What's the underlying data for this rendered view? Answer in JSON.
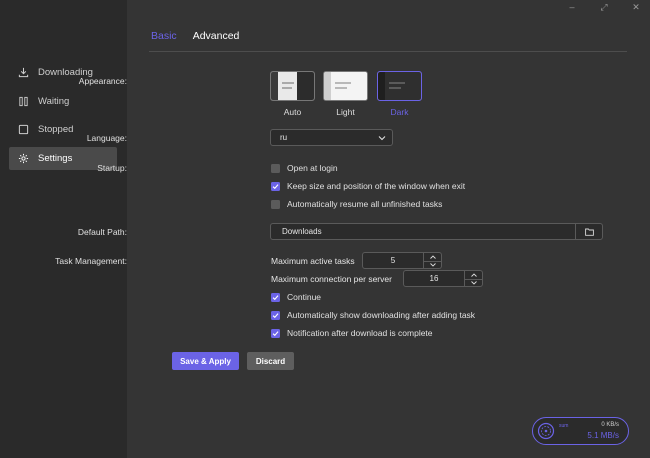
{
  "window_controls": {
    "minimize": "–",
    "maximize": "⤢",
    "close": "✕"
  },
  "sidebar": {
    "items": [
      {
        "label": "Downloading",
        "icon": "download-icon"
      },
      {
        "label": "Waiting",
        "icon": "pause-bars-icon"
      },
      {
        "label": "Stopped",
        "icon": "stop-square-icon"
      },
      {
        "label": "Settings",
        "icon": "gear-icon",
        "active": true
      }
    ]
  },
  "tabs": [
    {
      "label": "Basic",
      "active": true
    },
    {
      "label": "Advanced",
      "active": false
    }
  ],
  "form": {
    "appearance": {
      "label": "Appearance:",
      "options": [
        "Auto",
        "Light",
        "Dark"
      ],
      "selected": "Dark"
    },
    "language": {
      "label": "Language:",
      "value": "ru"
    },
    "startup": {
      "label": "Startup:",
      "options": [
        {
          "label": "Open at login",
          "checked": false
        },
        {
          "label": "Keep size and position of the window when exit",
          "checked": true
        },
        {
          "label": "Automatically resume all unfinished tasks",
          "checked": false
        }
      ]
    },
    "default_path": {
      "label": "Default Path:",
      "value": "Downloads"
    },
    "task_management": {
      "label": "Task Management:",
      "max_active_label": "Maximum active tasks",
      "max_active_value": "5",
      "max_conn_label": "Maximum connection per server",
      "max_conn_value": "16",
      "options": [
        {
          "label": "Continue",
          "checked": true
        },
        {
          "label": "Automatically show downloading after adding task",
          "checked": true
        },
        {
          "label": "Notification after download is complete",
          "checked": true
        }
      ]
    }
  },
  "buttons": {
    "save": "Save & Apply",
    "discard": "Discard"
  },
  "speedometer": {
    "mini_label": "sum",
    "upload": "0 KB/s",
    "download": "5.1 MB/s"
  },
  "colors": {
    "accent": "#6b63e6",
    "background": "#343434",
    "sidebar": "#2a2a2a"
  }
}
